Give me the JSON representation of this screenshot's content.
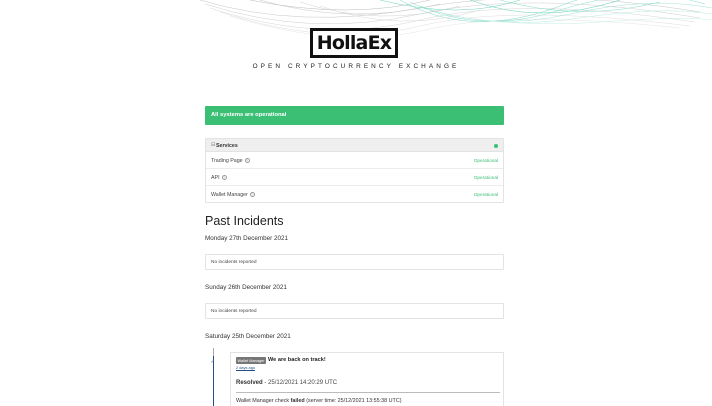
{
  "brand": {
    "logo_text": "HollaEx",
    "tagline": "OPEN CRYPTOCURRENCY EXCHANGE"
  },
  "status_banner": {
    "text": "All systems are operational",
    "color": "#3bbf75"
  },
  "services": {
    "title": "Services",
    "collapse_symbol": "⊟",
    "items": [
      {
        "name": "Trading Page",
        "status": "Operational"
      },
      {
        "name": "API",
        "status": "Operational"
      },
      {
        "name": "Wallet Manager",
        "status": "Operational"
      }
    ]
  },
  "past_incidents": {
    "title": "Past Incidents",
    "days": [
      {
        "date": "Monday 27th December 2021",
        "message": "No incidents reported"
      },
      {
        "date": "Sunday 26th December 2021",
        "message": "No incidents reported"
      },
      {
        "date": "Saturday 25th December 2021"
      }
    ],
    "incident": {
      "tag": "Wallet Manager",
      "title": "We are back on track!",
      "time_ago": "2 days ago",
      "resolved_label": "Resolved",
      "resolved_time": " - 25/12/2021 14:20:29 UTC",
      "detail_prefix": "Wallet Manager check ",
      "detail_status": "failed",
      "detail_suffix": " (server time: 25/12/2021 13:55:38 UTC)"
    }
  },
  "icons": {
    "help": "question-circle-icon",
    "resolved": "check-icon"
  }
}
